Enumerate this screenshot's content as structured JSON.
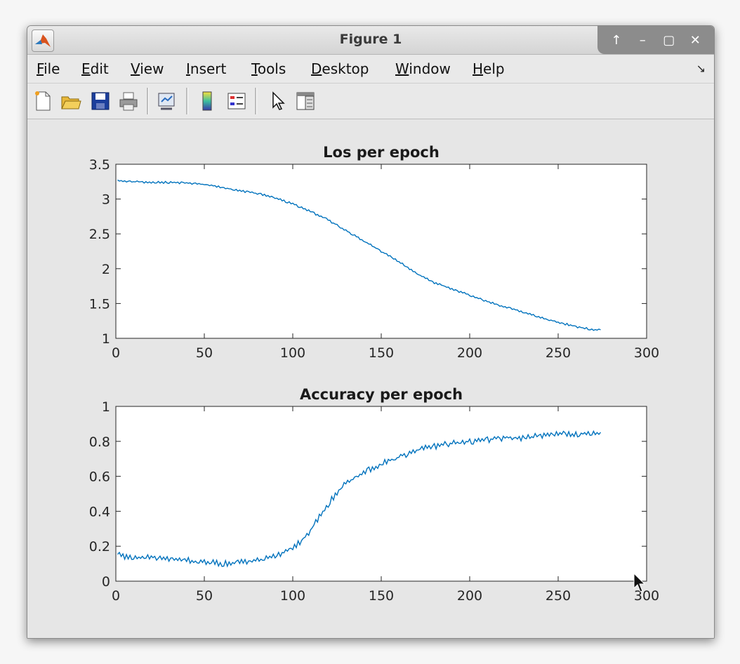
{
  "window": {
    "title": "Figure 1"
  },
  "menu": [
    {
      "label": "File",
      "key": "F",
      "rest": "ile"
    },
    {
      "label": "Edit",
      "key": "E",
      "rest": "dit"
    },
    {
      "label": "View",
      "key": "V",
      "rest": "iew"
    },
    {
      "label": "Insert",
      "key": "I",
      "rest": "nsert"
    },
    {
      "label": "Tools",
      "key": "T",
      "rest": "ools"
    },
    {
      "label": "Desktop",
      "key": "D",
      "rest": "esktop"
    },
    {
      "label": "Window",
      "key": "W",
      "rest": "indow"
    },
    {
      "label": "Help",
      "key": "H",
      "rest": "elp"
    }
  ],
  "toolbar": [
    "new-figure-icon",
    "open-file-icon",
    "save-icon",
    "print-icon",
    "link-plot-icon",
    "colorbar-icon",
    "legend-icon",
    "pointer-icon",
    "property-inspector-icon"
  ],
  "colors": {
    "line": "#0072bd",
    "axes_bg": "#ffffff",
    "fig_bg": "#e6e6e6"
  },
  "chart_data": [
    {
      "type": "line",
      "title": "Los per epoch",
      "xlim": [
        0,
        300
      ],
      "ylim": [
        1,
        3.5
      ],
      "xticks": [
        "0",
        "50",
        "100",
        "150",
        "200",
        "250",
        "300"
      ],
      "yticks": [
        "1",
        "1.5",
        "2",
        "2.5",
        "3",
        "3.5"
      ],
      "grid": false,
      "x": [
        1,
        10,
        20,
        30,
        40,
        50,
        60,
        70,
        80,
        90,
        100,
        110,
        120,
        130,
        140,
        150,
        160,
        170,
        180,
        190,
        200,
        210,
        220,
        230,
        240,
        250,
        260,
        270,
        274
      ],
      "values": [
        3.26,
        3.25,
        3.24,
        3.24,
        3.23,
        3.21,
        3.17,
        3.12,
        3.08,
        3.02,
        2.93,
        2.82,
        2.7,
        2.55,
        2.4,
        2.25,
        2.1,
        1.93,
        1.8,
        1.71,
        1.62,
        1.53,
        1.45,
        1.38,
        1.3,
        1.23,
        1.17,
        1.12,
        1.13
      ]
    },
    {
      "type": "line",
      "title": "Accuracy per epoch",
      "xlim": [
        0,
        300
      ],
      "ylim": [
        0,
        1
      ],
      "xticks": [
        "0",
        "50",
        "100",
        "150",
        "200",
        "250",
        "300"
      ],
      "yticks": [
        "0",
        "0.2",
        "0.4",
        "0.6",
        "0.8",
        "1"
      ],
      "grid": false,
      "x": [
        1,
        10,
        20,
        30,
        40,
        50,
        60,
        70,
        80,
        90,
        100,
        105,
        110,
        115,
        120,
        125,
        130,
        140,
        150,
        160,
        170,
        180,
        190,
        200,
        210,
        220,
        230,
        240,
        250,
        260,
        270,
        274
      ],
      "values": [
        0.15,
        0.13,
        0.14,
        0.13,
        0.12,
        0.11,
        0.1,
        0.11,
        0.12,
        0.14,
        0.19,
        0.23,
        0.29,
        0.37,
        0.44,
        0.51,
        0.56,
        0.62,
        0.67,
        0.71,
        0.75,
        0.77,
        0.79,
        0.8,
        0.81,
        0.82,
        0.82,
        0.83,
        0.84,
        0.84,
        0.85,
        0.85
      ]
    }
  ]
}
